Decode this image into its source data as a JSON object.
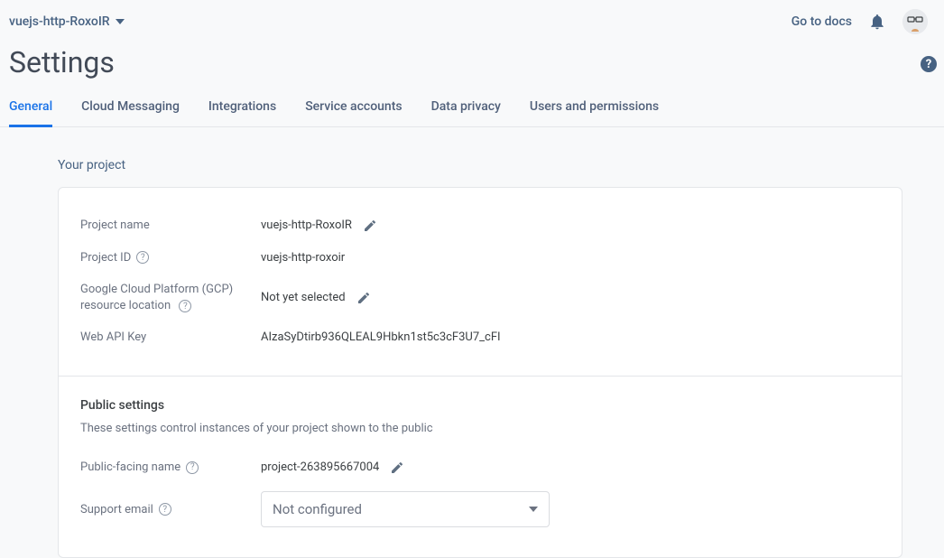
{
  "header": {
    "project_selector": "vuejs-http-RoxoIR",
    "docs_link": "Go to docs"
  },
  "page_title": "Settings",
  "tabs": [
    {
      "label": "General",
      "active": true
    },
    {
      "label": "Cloud Messaging",
      "active": false
    },
    {
      "label": "Integrations",
      "active": false
    },
    {
      "label": "Service accounts",
      "active": false
    },
    {
      "label": "Data privacy",
      "active": false
    },
    {
      "label": "Users and permissions",
      "active": false
    }
  ],
  "your_project": {
    "section_label": "Your project",
    "rows": {
      "project_name_label": "Project name",
      "project_name_value": "vuejs-http-RoxoIR",
      "project_id_label": "Project ID",
      "project_id_value": "vuejs-http-roxoir",
      "gcp_label_line1": "Google Cloud Platform (GCP)",
      "gcp_label_line2": "resource location",
      "gcp_value": "Not yet selected",
      "web_api_key_label": "Web API Key",
      "web_api_key_value": "AIzaSyDtirb936QLEAL9Hbkn1st5c3cF3U7_cFI"
    }
  },
  "public_settings": {
    "header": "Public settings",
    "description": "These settings control instances of your project shown to the public",
    "public_name_label": "Public-facing name",
    "public_name_value": "project-263895667004",
    "support_email_label": "Support email",
    "support_email_value": "Not configured"
  }
}
